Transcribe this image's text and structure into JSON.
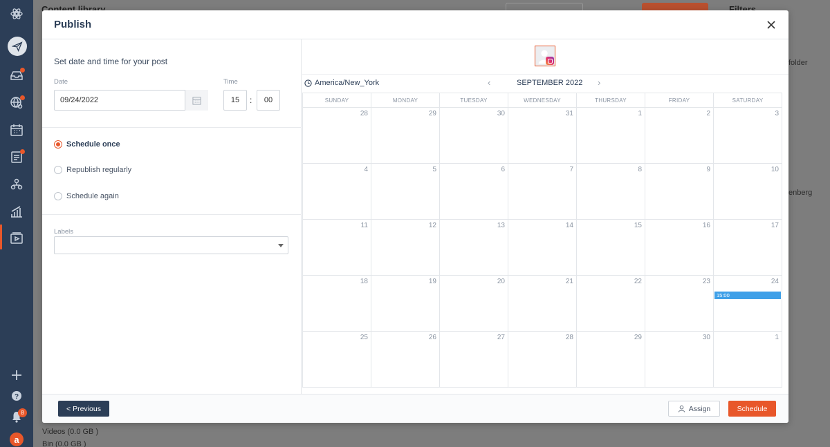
{
  "background": {
    "header_title": "Content library",
    "bottom_items": [
      "Videos (0.0 GB )",
      "Bin (0.0 GB )"
    ],
    "right_panel_title": "Filters",
    "right_snippets": [
      "folder",
      "enberg"
    ],
    "notification_count": "8",
    "brand_letter": "a"
  },
  "modal": {
    "title": "Publish",
    "left": {
      "section_title": "Set date and time for your post",
      "date_label": "Date",
      "date_value": "09/24/2022",
      "time_label": "Time",
      "hour": "15",
      "minute": "00",
      "colon": ":",
      "radio_options": [
        {
          "label": "Schedule once",
          "selected": true
        },
        {
          "label": "Republish regularly",
          "selected": false
        },
        {
          "label": "Schedule again",
          "selected": false
        }
      ],
      "labels_label": "Labels",
      "labels_value": ""
    },
    "calendar": {
      "timezone": "America/New_York",
      "month": "SEPTEMBER 2022",
      "weekdays": [
        "SUNDAY",
        "MONDAY",
        "TUESDAY",
        "WEDNESDAY",
        "THURSDAY",
        "FRIDAY",
        "SATURDAY"
      ],
      "weeks": [
        [
          "28",
          "29",
          "30",
          "31",
          "1",
          "2",
          "3"
        ],
        [
          "4",
          "5",
          "6",
          "7",
          "8",
          "9",
          "10"
        ],
        [
          "11",
          "12",
          "13",
          "14",
          "15",
          "16",
          "17"
        ],
        [
          "18",
          "19",
          "20",
          "21",
          "22",
          "23",
          "24"
        ],
        [
          "25",
          "26",
          "27",
          "28",
          "29",
          "30",
          "1"
        ]
      ],
      "event": {
        "week": 3,
        "day": 6,
        "label": "15:00",
        "color": "#3fa0e8"
      }
    },
    "footer": {
      "previous_label": "< Previous",
      "assign_label": "Assign",
      "schedule_label": "Schedule"
    }
  },
  "colors": {
    "accent": "#e8572a",
    "nav": "#2c3e57",
    "event": "#3fa0e8"
  }
}
